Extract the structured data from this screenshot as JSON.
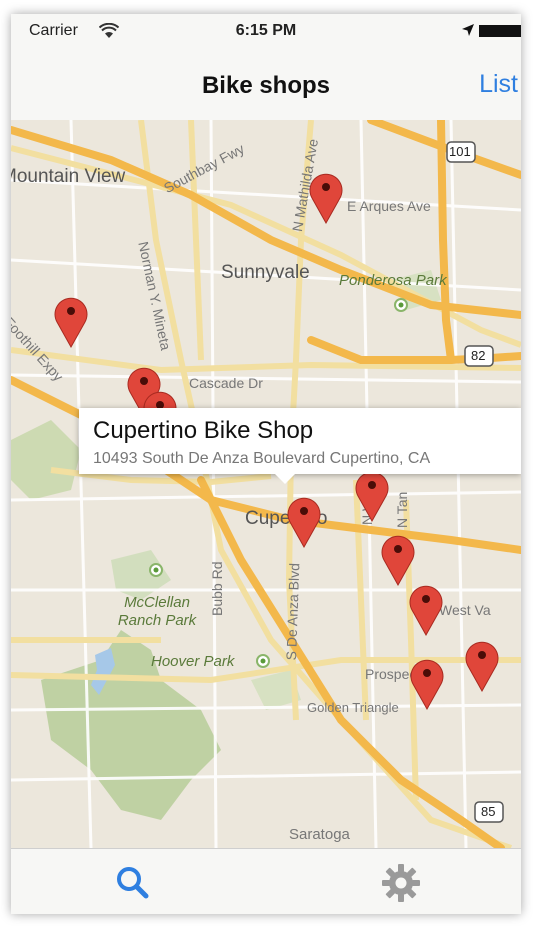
{
  "status_bar": {
    "carrier": "Carrier",
    "time": "6:15 PM"
  },
  "nav": {
    "title": "Bike shops",
    "list_label": "List"
  },
  "map": {
    "labels": {
      "mountain_view": "Mountain View",
      "sunnyvale": "Sunnyvale",
      "ponderosa_park": "Ponderosa Park",
      "cascade_dr": "Cascade Dr",
      "cupertino": "Cupertino",
      "mcclellan_ranch_park": "McClellan Ranch Park",
      "hoover_park": "Hoover Park",
      "saratoga": "Saratoga",
      "golden_triangle": "Golden Triangle",
      "west_valley": "West Va",
      "prospect_rd": "Prospect Rd",
      "e_arques_ave": "E Arques Ave",
      "southbay_fwy": "Southbay Fwy",
      "n_mathilda_ave": "N Mathilda Ave",
      "norman_y_mineta": "Norman Y. Mineta",
      "foothill_expy": "Foothill Expy",
      "bubb_rd": "Bubb Rd",
      "s_de_anza_blvd": "S De Anza Blvd",
      "n_wolfe": "N Wo",
      "n_tantau": "N Tan"
    },
    "shields": [
      "101",
      "82",
      "85"
    ]
  },
  "callout": {
    "title": "Cupertino Bike Shop",
    "address": "10493 South De Anza Boulevard Cupertino, CA"
  },
  "colors": {
    "accent": "#2f7fe0",
    "pin": "#e0463a",
    "highway": "#f3b84b",
    "road": "#f2dfa0"
  },
  "tabs": [
    {
      "name": "search",
      "icon": "search-icon",
      "selected": true
    },
    {
      "name": "settings",
      "icon": "gear-icon",
      "selected": false
    }
  ]
}
